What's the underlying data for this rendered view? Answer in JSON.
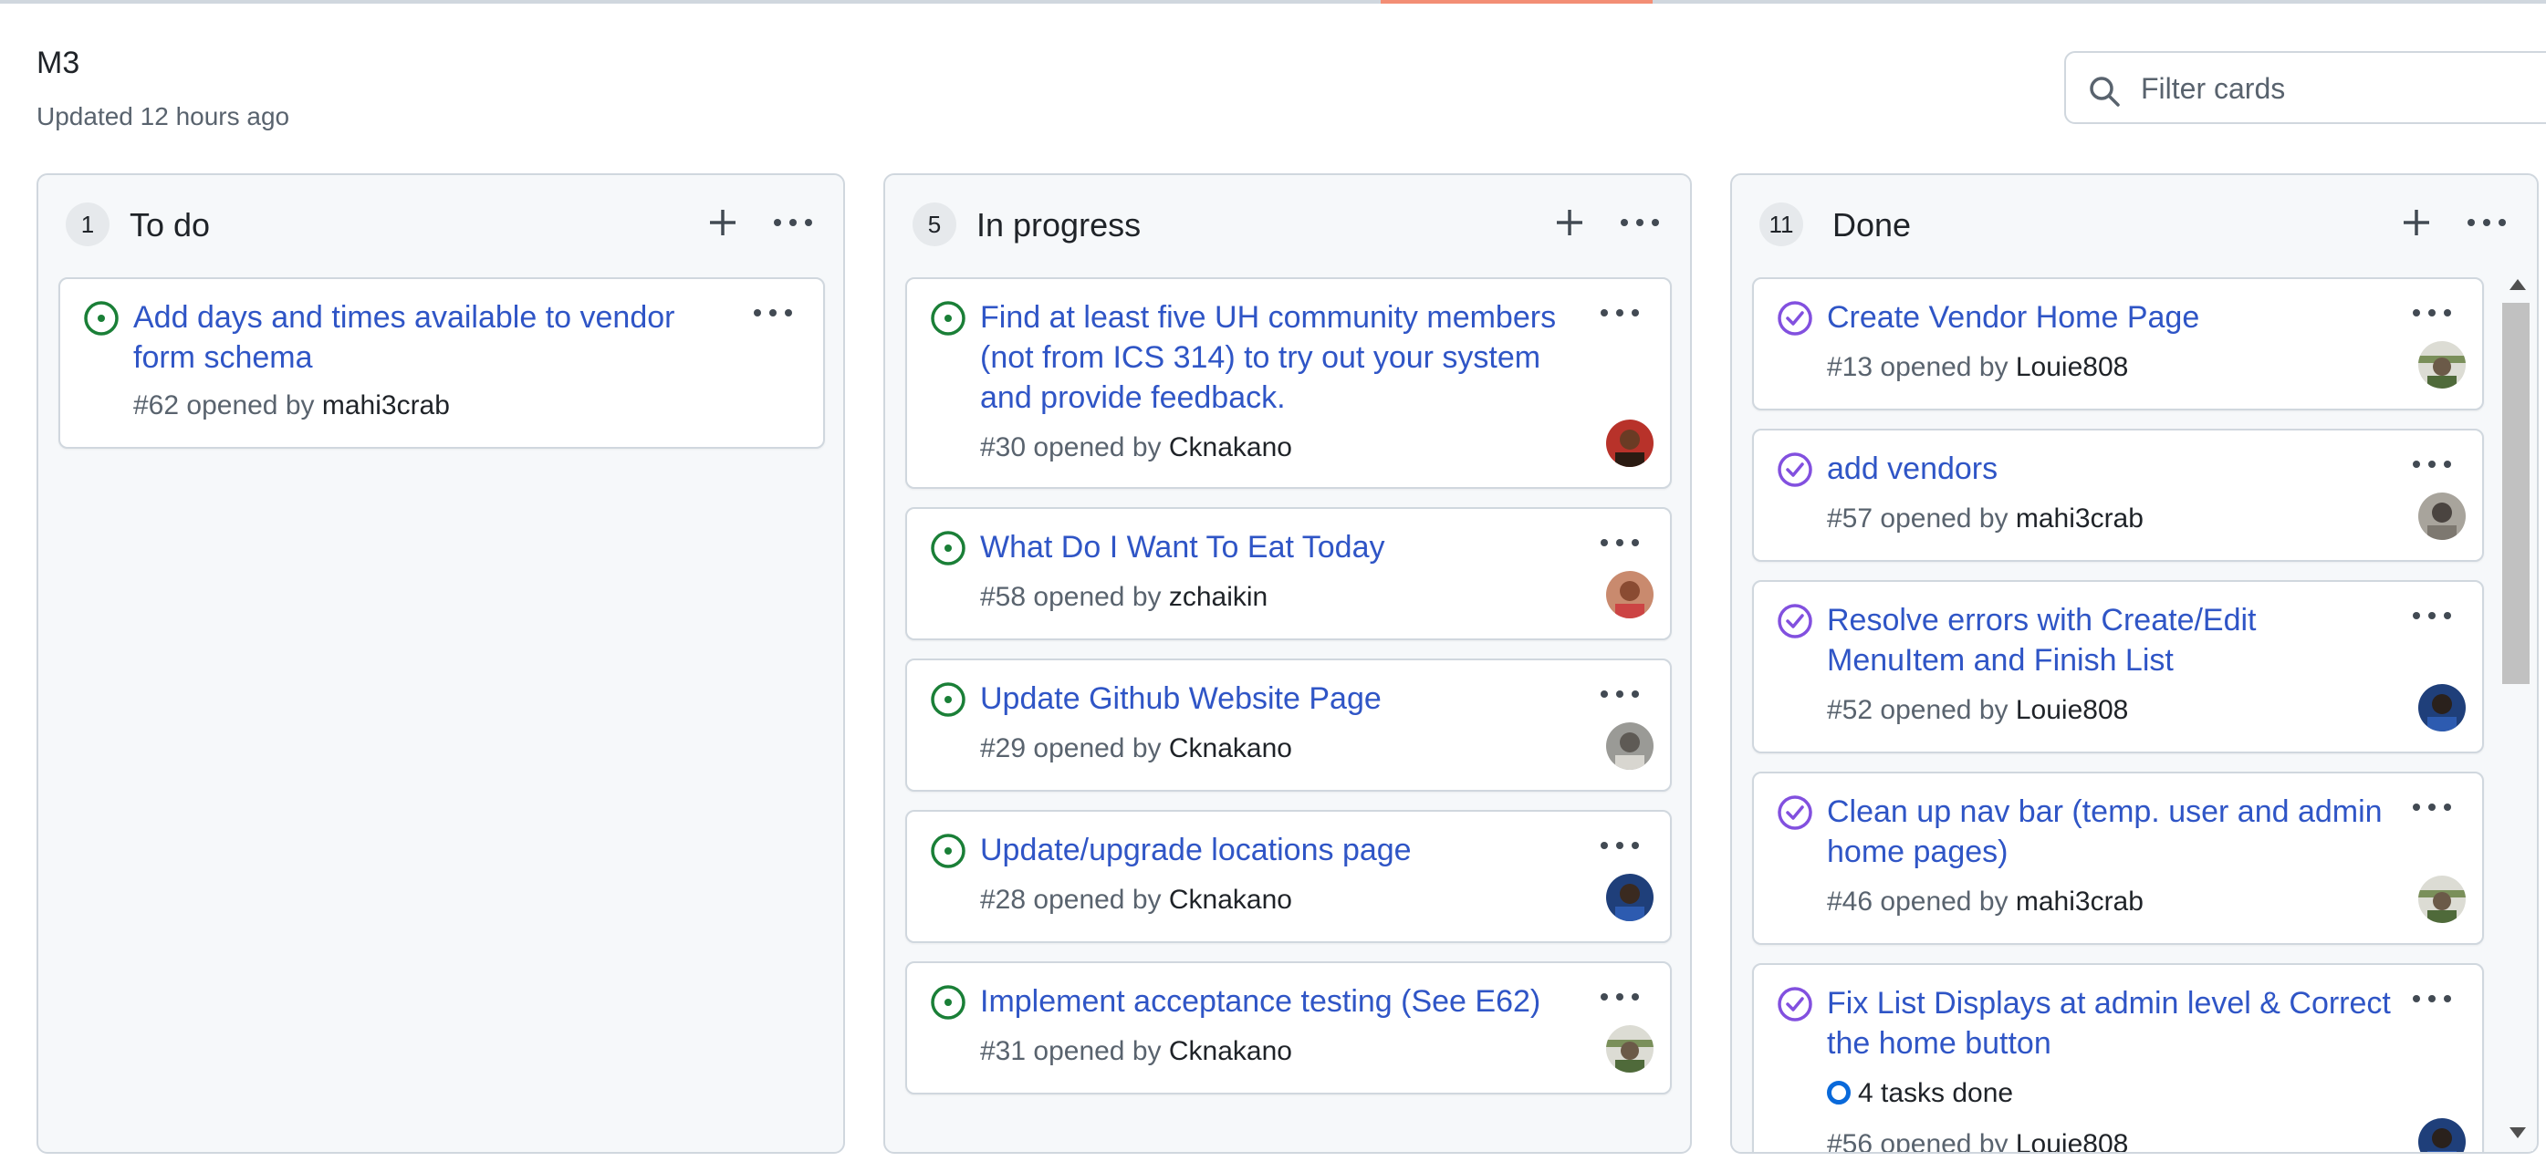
{
  "header": {
    "title": "M3",
    "updated": "Updated 12 hours ago",
    "filter_placeholder": "Filter cards"
  },
  "columns": [
    {
      "count": "1",
      "title": "To do",
      "cards": [
        {
          "title": "Add days and times available to vendor form schema",
          "meta": "#62 opened by ",
          "author": "mahi3crab",
          "status": "open"
        }
      ]
    },
    {
      "count": "5",
      "title": "In progress",
      "cards": [
        {
          "title": "Find at least five UH community members (not from ICS 314) to try out your system and provide feedback.",
          "meta": "#30 opened by ",
          "author": "Cknakano",
          "status": "open"
        },
        {
          "title": "What Do I Want To Eat Today",
          "meta": "#58 opened by ",
          "author": "zchaikin",
          "status": "open"
        },
        {
          "title": "Update Github Website Page",
          "meta": "#29 opened by ",
          "author": "Cknakano",
          "status": "open"
        },
        {
          "title": "Update/upgrade locations page",
          "meta": "#28 opened by ",
          "author": "Cknakano",
          "status": "open"
        },
        {
          "title": "Implement acceptance testing (See E62)",
          "meta": "#31 opened by ",
          "author": "Cknakano",
          "status": "open"
        }
      ]
    },
    {
      "count": "11",
      "title": "Done",
      "cards": [
        {
          "title": "Create Vendor Home Page",
          "meta": "#13 opened by ",
          "author": "Louie808",
          "status": "closed"
        },
        {
          "title": "add vendors",
          "meta": "#57 opened by ",
          "author": "mahi3crab",
          "status": "closed"
        },
        {
          "title": "Resolve errors with Create/Edit MenuItem and Finish List",
          "meta": "#52 opened by ",
          "author": "Louie808",
          "status": "closed"
        },
        {
          "title": "Clean up nav bar (temp. user and admin home pages)",
          "meta": "#46 opened by ",
          "author": "mahi3crab",
          "status": "closed"
        },
        {
          "title": "Fix List Displays at admin level & Correct the home button",
          "tasks": "4 tasks done",
          "meta": "#56 opened by ",
          "author": "Louie808",
          "status": "closed"
        }
      ]
    }
  ],
  "colors": {
    "link": "#2f55c6",
    "open_icon": "#1a7f37",
    "closed_icon": "#8250df",
    "accent_bar": "#f38e75"
  },
  "icons": {
    "search": "search-icon",
    "add": "plus-icon",
    "more": "kebab-horizontal-icon",
    "open": "issue-opened-icon",
    "closed": "issue-closed-icon"
  }
}
